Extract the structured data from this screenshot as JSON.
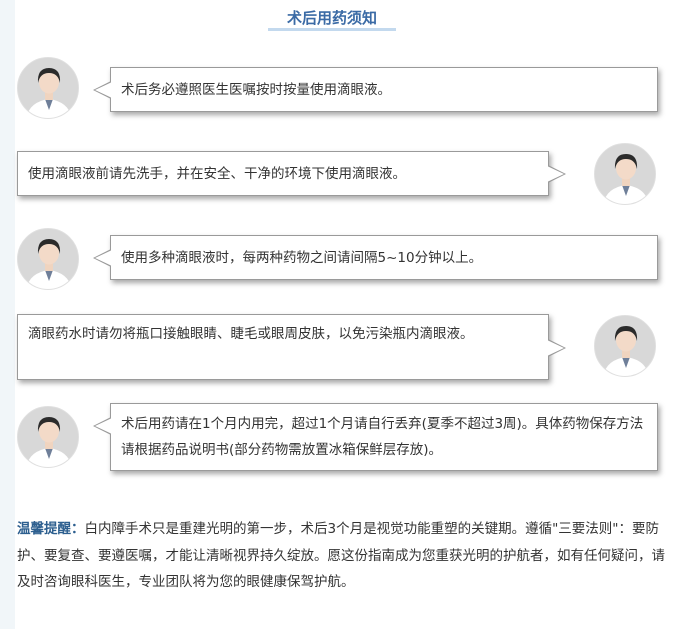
{
  "title": "术后用药须知",
  "messages": [
    {
      "text": "术后务必遵照医生医嘱按时按量使用滴眼液。"
    },
    {
      "text": "使用滴眼液前请先洗手，并在安全、干净的环境下使用滴眼液。"
    },
    {
      "text": "使用多种滴眼液时，每两种药物之间请间隔5~10分钟以上。"
    },
    {
      "text": "滴眼药水时请勿将瓶口接触眼睛、睫毛或眼周皮肤，以免污染瓶内滴眼液。"
    },
    {
      "text": "术后用药请在1个月内用完，超过1个月请自行丢弃(夏季不超过3周)。具体药物保存方法请根据药品说明书(部分药物需放置冰箱保鲜层存放)。"
    }
  ],
  "tip": {
    "label": "温馨提醒：",
    "text": "白内障手术只是重建光明的第一步，术后3个月是视觉功能重塑的关键期。遵循\"三要法则\"：要防护、要复查、要遵医嘱，才能让清晰视界持久绽放。愿这份指南成为您重获光明的护航者，如有任何疑问，请及时咨询眼科医生，专业团队将为您的眼健康保驾护航。"
  },
  "colors": {
    "title": "#3a6aa5",
    "tip_label": "#2d5f8f",
    "bubble_border": "#9a9a9a"
  }
}
